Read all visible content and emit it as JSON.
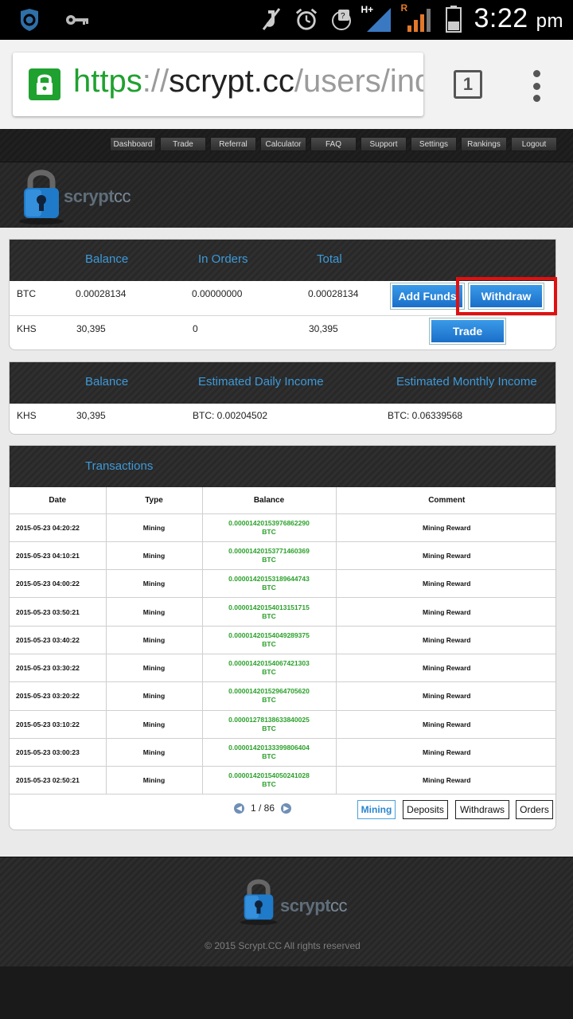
{
  "status_bar": {
    "time": "3:22",
    "ampm": "pm",
    "network_h": "H+",
    "network_r": "R"
  },
  "browser": {
    "url_scheme": "https",
    "url_sep": "://",
    "url_host": "scrypt.cc",
    "url_path": "/users/index",
    "tab_count": "1"
  },
  "nav": {
    "items": [
      "Dashboard",
      "Trade",
      "Referral",
      "Calculator",
      "FAQ",
      "Support",
      "Settings",
      "Rankings",
      "Logout"
    ]
  },
  "logo": {
    "text_bold": "scrypt",
    "text_light": "cc"
  },
  "balances": {
    "headers": [
      "Balance",
      "In Orders",
      "Total"
    ],
    "rows": [
      {
        "currency": "BTC",
        "balance": "0.00028134",
        "in_orders": "0.00000000",
        "total": "0.00028134"
      },
      {
        "currency": "KHS",
        "balance": "30,395",
        "in_orders": "0",
        "total": "30,395"
      }
    ],
    "add_funds_label": "Add Funds",
    "withdraw_label": "Withdraw",
    "trade_label": "Trade"
  },
  "income": {
    "headers": [
      "Balance",
      "Estimated Daily Income",
      "Estimated Monthly Income"
    ],
    "row": {
      "currency": "KHS",
      "balance": "30,395",
      "daily": "BTC: 0.00204502",
      "monthly": "BTC: 0.06339568"
    }
  },
  "transactions": {
    "title": "Transactions",
    "columns": [
      "Date",
      "Type",
      "Balance",
      "Comment"
    ],
    "rows": [
      {
        "date": "2015-05-23 04:20:22",
        "type": "Mining",
        "amount": "0.00001420153976862290",
        "unit": "BTC",
        "comment": "Mining Reward"
      },
      {
        "date": "2015-05-23 04:10:21",
        "type": "Mining",
        "amount": "0.00001420153771460369",
        "unit": "BTC",
        "comment": "Mining Reward"
      },
      {
        "date": "2015-05-23 04:00:22",
        "type": "Mining",
        "amount": "0.00001420153189644743",
        "unit": "BTC",
        "comment": "Mining Reward"
      },
      {
        "date": "2015-05-23 03:50:21",
        "type": "Mining",
        "amount": "0.00001420154013151715",
        "unit": "BTC",
        "comment": "Mining Reward"
      },
      {
        "date": "2015-05-23 03:40:22",
        "type": "Mining",
        "amount": "0.00001420154049289375",
        "unit": "BTC",
        "comment": "Mining Reward"
      },
      {
        "date": "2015-05-23 03:30:22",
        "type": "Mining",
        "amount": "0.00001420154067421303",
        "unit": "BTC",
        "comment": "Mining Reward"
      },
      {
        "date": "2015-05-23 03:20:22",
        "type": "Mining",
        "amount": "0.00001420152964705620",
        "unit": "BTC",
        "comment": "Mining Reward"
      },
      {
        "date": "2015-05-23 03:10:22",
        "type": "Mining",
        "amount": "0.00001278138633840025",
        "unit": "BTC",
        "comment": "Mining Reward"
      },
      {
        "date": "2015-05-23 03:00:23",
        "type": "Mining",
        "amount": "0.00001420133399806404",
        "unit": "BTC",
        "comment": "Mining Reward"
      },
      {
        "date": "2015-05-23 02:50:21",
        "type": "Mining",
        "amount": "0.00001420154050241028",
        "unit": "BTC",
        "comment": "Mining Reward"
      }
    ],
    "pager": "1 / 86",
    "filters": [
      "Mining",
      "Deposits",
      "Withdraws",
      "Orders"
    ]
  },
  "footer": {
    "copyright": "© 2015 Scrypt.CC All rights reserved"
  },
  "colors": {
    "accent": "#3d9ad9",
    "positive": "#2aa02a",
    "secure": "#1fa12f",
    "highlight": "#e01010"
  }
}
